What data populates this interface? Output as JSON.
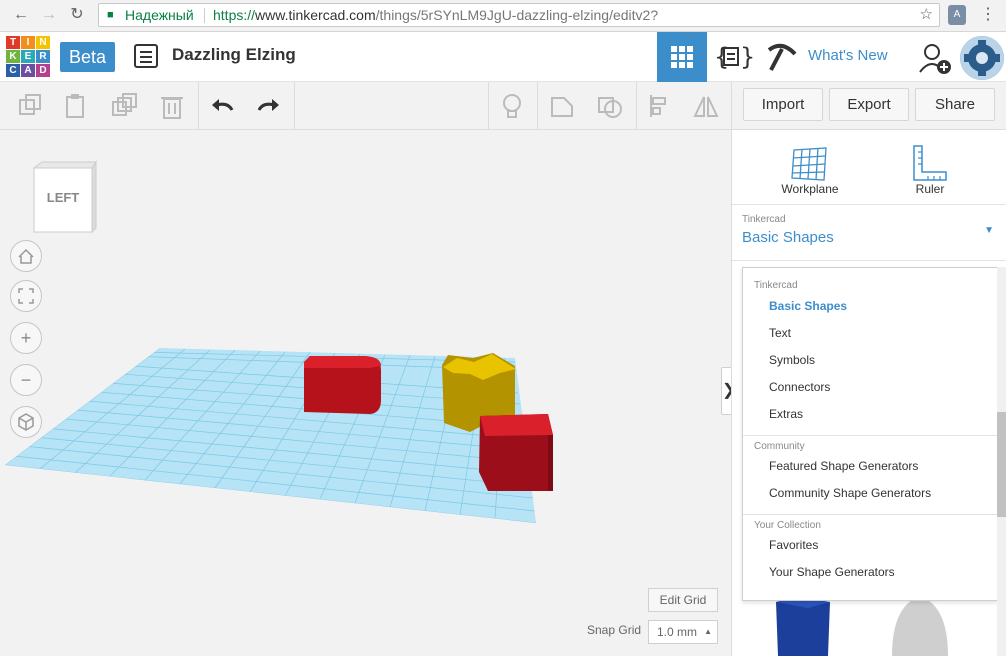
{
  "browser": {
    "secure_label": "Надежный",
    "url_scheme": "https://",
    "url_host": "www.tinkercad.com",
    "url_path": "/things/5rSYnLM9JgU-dazzling-elzing/editv2?"
  },
  "header": {
    "logo_letters": [
      "TIN",
      "KER",
      "CAD"
    ],
    "beta_label": "Beta",
    "design_title": "Dazzling Elzing",
    "whats_new": "What's New"
  },
  "toolbar": {
    "import_label": "Import",
    "export_label": "Export",
    "share_label": "Share"
  },
  "viewport": {
    "view_cube_face": "LEFT",
    "edit_grid_label": "Edit Grid",
    "snap_grid_label": "Snap Grid",
    "snap_grid_value": "1.0 mm"
  },
  "panel": {
    "workplane_label": "Workplane",
    "ruler_label": "Ruler",
    "library_category": "Tinkercad",
    "library_selected": "Basic Shapes"
  },
  "shape_menu": {
    "groups": [
      {
        "title": "Tinkercad",
        "items": [
          "Basic Shapes",
          "Text",
          "Symbols",
          "Connectors",
          "Extras"
        ]
      },
      {
        "title": "Community",
        "items": [
          "Featured Shape Generators",
          "Community Shape Generators"
        ]
      },
      {
        "title": "Your Collection",
        "items": [
          "Favorites",
          "Your Shape Generators"
        ]
      }
    ],
    "active_item": "Basic Shapes"
  },
  "colors": {
    "accent": "#3c8ecb",
    "grid": "#9fd8ee",
    "red_shape": "#c8102e",
    "yellow_shape": "#d4b000"
  }
}
